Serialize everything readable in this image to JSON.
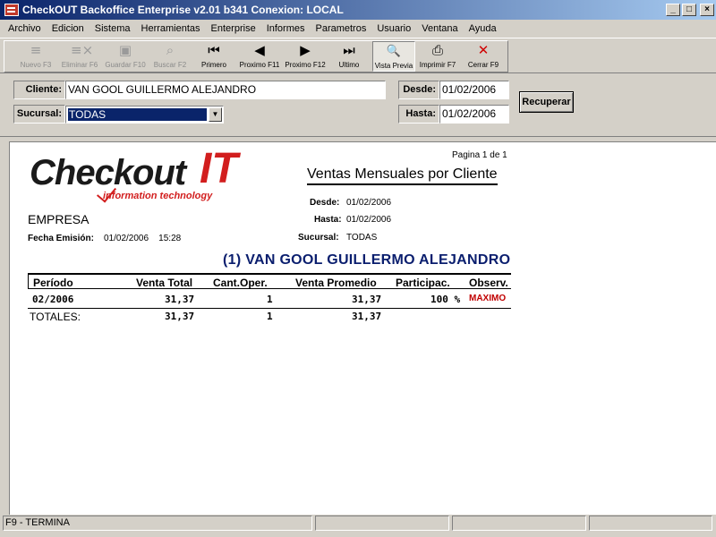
{
  "window": {
    "title": "CheckOUT Backoffice Enterprise v2.01 b341 Conexion: LOCAL",
    "buttons": {
      "minimize": "_",
      "maximize": "□",
      "close": "×"
    }
  },
  "menu": [
    "Archivo",
    "Edicion",
    "Sistema",
    "Herramientas",
    "Enterprise",
    "Informes",
    "Parametros",
    "Usuario",
    "Ventana",
    "Ayuda"
  ],
  "toolbar": {
    "nuevo": {
      "label": "Nuevo F3",
      "icon": "≡"
    },
    "eliminar": {
      "label": "Eliminar F6",
      "icon": "≡×"
    },
    "guardar": {
      "label": "Guardar F10",
      "icon": "▣"
    },
    "buscar": {
      "label": "Buscar F2",
      "icon": "⌕"
    },
    "primero": {
      "label": "Primero",
      "icon": "⏮"
    },
    "proximo_f11": {
      "label": "Proximo F11",
      "icon": "◀"
    },
    "proximo_f12": {
      "label": "Proximo F12",
      "icon": "▶"
    },
    "ultimo": {
      "label": "Ultimo",
      "icon": "⏭"
    },
    "vista_previa": {
      "label": "Vista Previa",
      "icon": "🔍"
    },
    "imprimir": {
      "label": "Imprimir F7",
      "icon": "⎙"
    },
    "cerrar": {
      "label": "Cerrar F9",
      "icon": "✕"
    }
  },
  "filters": {
    "cliente_label": "Cliente:",
    "cliente_value": "VAN GOOL GUILLERMO ALEJANDRO",
    "sucursal_label": "Sucursal:",
    "sucursal_value": "TODAS",
    "desde_label": "Desde:",
    "desde_value": "01/02/2006",
    "hasta_label": "Hasta:",
    "hasta_value": "01/02/2006",
    "recuperar": "Recuperar"
  },
  "report": {
    "logo_main": "Checkout",
    "logo_it": "IT",
    "logo_sub": "information technology",
    "pagina": "Pagina 1 de 1",
    "title": "Ventas Mensuales por Cliente",
    "desde_label": "Desde:",
    "desde_value": "01/02/2006",
    "hasta_label": "Hasta:",
    "hasta_value": "01/02/2006",
    "empresa": "EMPRESA",
    "fecha_emision_label": "Fecha Emisión:",
    "fecha_emision_value": "01/02/2006    15:28",
    "sucursal_label": "Sucursal:",
    "sucursal_value": "TODAS",
    "client_header": "(1)  VAN GOOL GUILLERMO ALEJANDRO",
    "columns": [
      "Período",
      "Venta Total",
      "Cant.Oper.",
      "Venta Promedio",
      "Participac.",
      "Observ."
    ],
    "rows": [
      {
        "periodo": "02/2006",
        "venta_total": "31,37",
        "cant_oper": "1",
        "venta_promedio": "31,37",
        "participac": "100 %",
        "observ": "MAXIMO"
      }
    ],
    "totales": {
      "label": "TOTALES:",
      "venta_total": "31,37",
      "cant_oper": "1",
      "venta_promedio": "31,37"
    }
  },
  "status": {
    "main": "F9 - TERMINA",
    "p2": "",
    "p3": "",
    "p4": ""
  },
  "colors": {
    "titlebar": "#0a246a",
    "logo_red": "#d21e1e",
    "client_blue": "#0a1e6e",
    "observ_red": "#c00000"
  }
}
